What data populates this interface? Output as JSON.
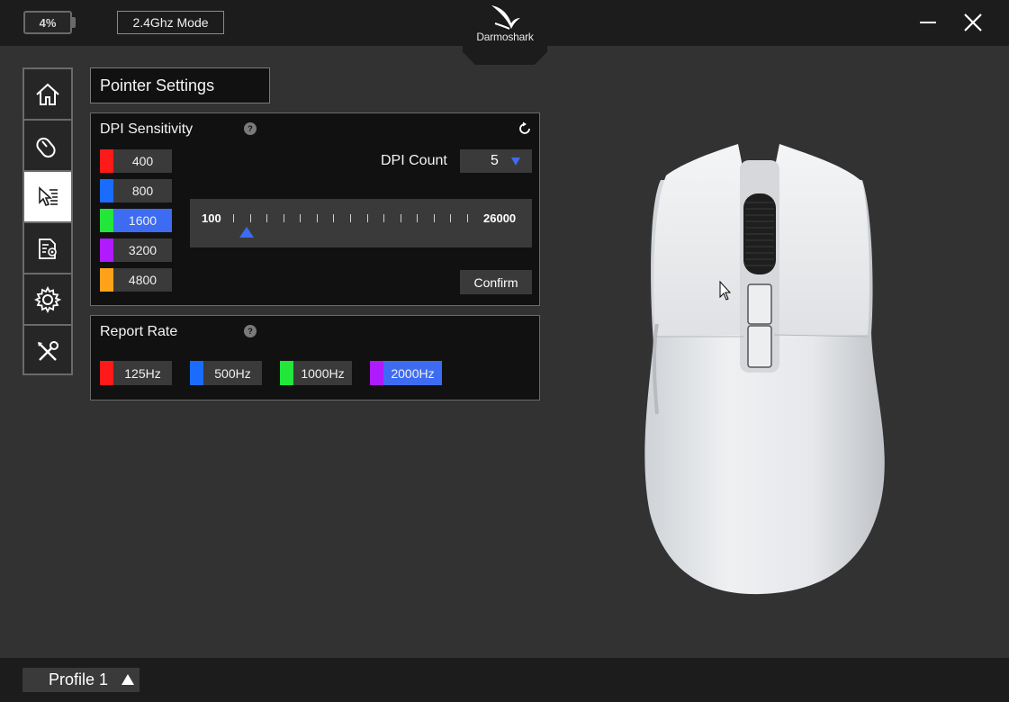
{
  "titlebar": {
    "battery": "4%",
    "mode": "2.4Ghz Mode",
    "brand": "Darmoshark"
  },
  "sidebar": {
    "items": [
      {
        "icon": "home-icon",
        "active": false
      },
      {
        "icon": "mouse-icon",
        "active": false
      },
      {
        "icon": "pointer-settings-icon",
        "active": true
      },
      {
        "icon": "macro-settings-icon",
        "active": false
      },
      {
        "icon": "gear-icon",
        "active": false
      },
      {
        "icon": "tools-icon",
        "active": false
      }
    ]
  },
  "page": {
    "title": "Pointer Settings"
  },
  "dpi": {
    "title": "DPI Sensitivity",
    "help": "?",
    "levels": [
      {
        "value": "400",
        "color": "#ff1a1a",
        "selected": false
      },
      {
        "value": "800",
        "color": "#1a6cff",
        "selected": false
      },
      {
        "value": "1600",
        "color": "#22e63a",
        "selected": true
      },
      {
        "value": "3200",
        "color": "#b01aff",
        "selected": false
      },
      {
        "value": "4800",
        "color": "#ffa21a",
        "selected": false
      }
    ],
    "count_label": "DPI Count",
    "count_value": "5",
    "slider_min": "100",
    "slider_max": "26000",
    "slider_value": 1600,
    "confirm": "Confirm"
  },
  "report_rate": {
    "title": "Report Rate",
    "help": "?",
    "options": [
      {
        "label": "125Hz",
        "color": "#ff1a1a",
        "selected": false
      },
      {
        "label": "500Hz",
        "color": "#1a6cff",
        "selected": false
      },
      {
        "label": "1000Hz",
        "color": "#22e63a",
        "selected": false
      },
      {
        "label": "2000Hz",
        "color": "#b01aff",
        "selected": true
      }
    ]
  },
  "footer": {
    "profile": "Profile 1"
  },
  "colors": {
    "accent": "#3d6cf2",
    "panel": "#111111",
    "background": "#323232"
  }
}
